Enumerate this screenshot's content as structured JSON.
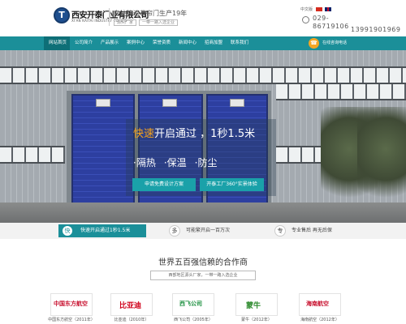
{
  "header": {
    "logo_mark": "T",
    "company_name": "西安开泰门业有限公司",
    "company_name_en": "XI'AN KAITAI INDUSTRY CO.,LTD",
    "slogan": "专注快速卷帘门生产19年",
    "slogan_sub": [
      "源头厂家",
      "一带一路入选企业"
    ],
    "lang_label": "中文版",
    "phone_area": "029-",
    "phone_main": "86719106",
    "phone_mobile": "13991901969"
  },
  "nav": {
    "items": [
      "网站首页",
      "公司简介",
      "产品展示",
      "案例中心",
      "荣誉资质",
      "新闻中心",
      "招商加盟",
      "联系我们"
    ],
    "active_index": 0,
    "hotline_icon": "phone-icon",
    "hotline_label": "在线咨询电话"
  },
  "banner": {
    "headline_highlight": "快速",
    "headline_rest": "开启通过 ，1秒1.5米",
    "points": [
      "·隔热",
      "·保温",
      "·防尘"
    ],
    "cta_primary": "申请免费设计方案",
    "cta_secondary": "开泰工厂360°实景体验"
  },
  "features": [
    {
      "icon": "快",
      "text": "快速开启通过1秒1.5米"
    },
    {
      "icon": "多",
      "text": "可能繁开启一百万次"
    },
    {
      "icon": "专",
      "text": "专业售后 再无后保"
    }
  ],
  "partners": {
    "title": "世界五百强信赖的合作商",
    "subtitle": "西部地区源头厂家，一带一路入选企业",
    "items": [
      {
        "logo_text": "中国东方航空",
        "caption": "中国东方航空（2011年）",
        "color": "#c8102e"
      },
      {
        "logo_text": "比亚迪",
        "caption": "比亚迪（2010年）",
        "color": "#d0021b"
      },
      {
        "logo_text": "西飞公司",
        "caption": "西飞公司（2005年）",
        "color": "#1a8f3e"
      },
      {
        "logo_text": "蒙牛",
        "caption": "蒙牛（2012年）",
        "color": "#2e8b2e"
      },
      {
        "logo_text": "海南航空",
        "caption": "海南航空（2012年）",
        "color": "#c8102e"
      }
    ]
  },
  "colors": {
    "brand_teal": "#1b8f99",
    "accent_orange": "#f6a21b",
    "door_blue": "#2d3fa0"
  }
}
